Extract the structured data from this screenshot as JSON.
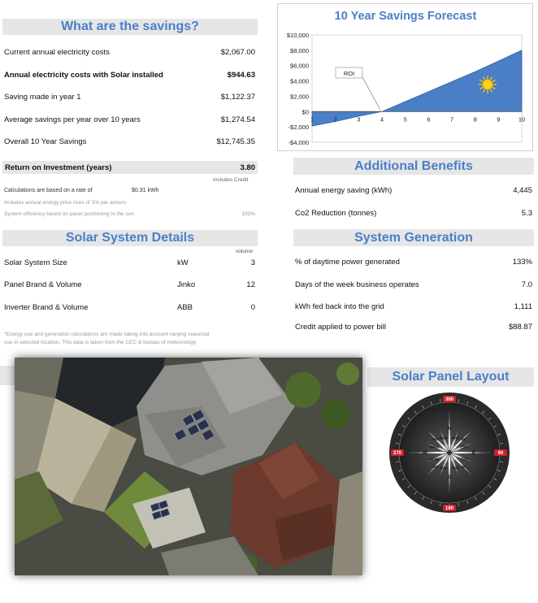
{
  "savings": {
    "header": "What are the savings?",
    "rows": [
      {
        "label": "Current annual electricity costs",
        "value": "$2,067.00"
      },
      {
        "label": "Annual electricity costs with Solar installed",
        "value": "$944.63"
      },
      {
        "label": "Saving made in year 1",
        "value": "$1,122.37"
      },
      {
        "label": "Average savings per year over  10 years",
        "value": "$1,274.54"
      },
      {
        "label": "Overall 10 Year Savings",
        "value": "$12,745.35"
      }
    ],
    "roi_label": "Return on Investment  (years)",
    "roi_value": "3.80",
    "includes_credit": "Includes Credit",
    "rate_text": "Calculations are based on a rate of",
    "rate_value": "$0.31  kWh",
    "price_rise_note": "Includes annual energy price rises of 3% per annum.",
    "efficiency_note": "System efficiency based on panel positioning to the sun",
    "efficiency_value": "100%"
  },
  "solar_system": {
    "header": "Solar System Details",
    "volume_label": "volume",
    "rows": [
      {
        "label": "Solar System Size",
        "unit": "kW",
        "value": "3"
      },
      {
        "label": "Panel Brand & Volume",
        "unit": "Jinko",
        "value": "12"
      },
      {
        "label": "Inverter Brand & Volume",
        "unit": "ABB",
        "value": "0"
      }
    ],
    "footnote_line1": "*Energy use and generation calculations are made taking into account varying seasonal",
    "footnote_line2": "use in selected location. This data is taken from the CEC &  bureau of meteorology."
  },
  "benefits": {
    "header": "Additional Benefits",
    "rows": [
      {
        "label": "Annual energy saving (kWh)",
        "value": "4,445"
      },
      {
        "label": "Co2 Reduction (tonnes)",
        "value": "5.3"
      }
    ]
  },
  "generation": {
    "header": "System Generation",
    "rows": [
      {
        "label": "% of daytime power generated",
        "value": "133%"
      },
      {
        "label": "Days of the week business operates",
        "value": "7.0"
      },
      {
        "label": "kWh fed back into the grid",
        "value": "1,111"
      },
      {
        "label": "Credit applied to power bill",
        "value": "$88.87"
      }
    ]
  },
  "layout": {
    "header": "Solar Panel Layout",
    "compass_labels": [
      "N",
      "NNE",
      "NE",
      "ENE",
      "E",
      "ESE",
      "SE",
      "SSE",
      "S",
      "SSW",
      "SW",
      "WSW",
      "W",
      "WNW",
      "NW",
      "NNW"
    ],
    "compass_markers": [
      "360",
      "90",
      "180",
      "270"
    ]
  },
  "chart_data": {
    "type": "area",
    "title": "10 Year Savings Forecast",
    "x": [
      1,
      2,
      3,
      4,
      5,
      6,
      7,
      8,
      9,
      10
    ],
    "series": [
      {
        "values": [
          -1900,
          -1300,
          -600,
          0,
          1300,
          2600,
          3900,
          5200,
          6600,
          8000
        ]
      }
    ],
    "ylim": [
      -4000,
      10000
    ],
    "yticks": [
      "$10,000",
      "$8,000",
      "$6,000",
      "$4,000",
      "$2,000",
      "$0",
      "-$2,000",
      "-$4,000"
    ],
    "xticks": [
      "1",
      "2",
      "3",
      "4",
      "5",
      "6",
      "7",
      "8",
      "9",
      "10"
    ],
    "annotation": "ROI",
    "colors": {
      "area": "#4a7fc8",
      "title": "#4a7fc8"
    }
  }
}
